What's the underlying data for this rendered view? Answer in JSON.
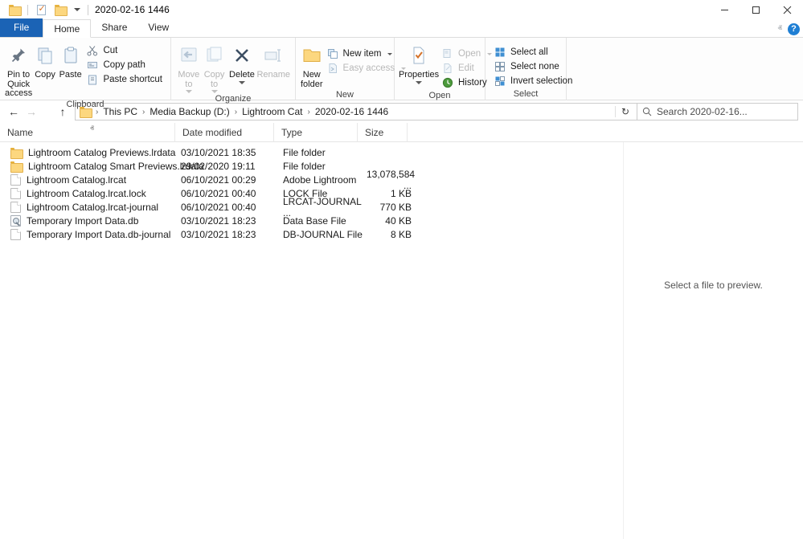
{
  "titlebar": {
    "title": "2020-02-16 1446",
    "quick_access": [
      {
        "name": "folder-icon",
        "label": "Folder"
      },
      {
        "name": "properties-icon",
        "label": "Properties"
      },
      {
        "name": "new-folder-icon",
        "label": "New folder"
      },
      {
        "name": "customize-caret-icon",
        "label": "Customize Quick Access Toolbar"
      }
    ],
    "controls": {
      "minimize": "–",
      "maximize": "□",
      "close": "×"
    }
  },
  "tabs": [
    {
      "label": "File",
      "kind": "file"
    },
    {
      "label": "Home",
      "kind": "active"
    },
    {
      "label": "Share",
      "kind": "normal"
    },
    {
      "label": "View",
      "kind": "normal"
    }
  ],
  "ribbon_right": {
    "collapse": "ⱏ",
    "help": "?"
  },
  "ribbon": {
    "groups": [
      {
        "title": "Clipboard",
        "big": [
          {
            "label": "Pin to Quick\naccess",
            "icon": "pin-icon",
            "disabled": false
          },
          {
            "label": "Copy",
            "icon": "copy-icon",
            "disabled": false
          },
          {
            "label": "Paste",
            "icon": "paste-icon",
            "disabled": false
          }
        ],
        "small": [
          {
            "label": "Cut",
            "icon": "scissors-icon",
            "disabled": false
          },
          {
            "label": "Copy path",
            "icon": "copy-path-icon",
            "disabled": false
          },
          {
            "label": "Paste shortcut",
            "icon": "paste-shortcut-icon",
            "disabled": false
          }
        ]
      },
      {
        "title": "Organize",
        "big": [
          {
            "label": "Move\nto",
            "icon": "move-to-icon",
            "disabled": true,
            "caret": true
          },
          {
            "label": "Copy\nto",
            "icon": "copy-to-icon",
            "disabled": true,
            "caret": true
          },
          {
            "label": "Delete",
            "icon": "delete-x-icon",
            "disabled": false,
            "caret": true
          },
          {
            "label": "Rename",
            "icon": "rename-icon",
            "disabled": true
          }
        ],
        "small": []
      },
      {
        "title": "New",
        "big": [
          {
            "label": "New\nfolder",
            "icon": "new-folder-icon",
            "disabled": false
          }
        ],
        "small": [
          {
            "label": "New item",
            "icon": "new-item-icon",
            "disabled": false,
            "caret": true
          },
          {
            "label": "Easy access",
            "icon": "easy-access-icon",
            "disabled": true,
            "caret": true
          }
        ]
      },
      {
        "title": "Open",
        "big": [
          {
            "label": "Properties",
            "icon": "properties-icon",
            "disabled": false,
            "caret": true
          }
        ],
        "small": [
          {
            "label": "Open",
            "icon": "open-icon",
            "disabled": true,
            "caret": true
          },
          {
            "label": "Edit",
            "icon": "edit-icon",
            "disabled": true
          },
          {
            "label": "History",
            "icon": "history-icon",
            "disabled": false
          }
        ]
      },
      {
        "title": "Select",
        "big": [],
        "small": [
          {
            "label": "Select all",
            "icon": "select-all-icon",
            "disabled": false
          },
          {
            "label": "Select none",
            "icon": "select-none-icon",
            "disabled": false
          },
          {
            "label": "Invert selection",
            "icon": "invert-selection-icon",
            "disabled": false
          }
        ]
      }
    ]
  },
  "navigation": {
    "back": "←",
    "forward": "→",
    "recent": "ⱟ",
    "up": "↑",
    "breadcrumbs": [
      "This PC",
      "Media Backup (D:)",
      "Lightroom Cat",
      "2020-02-16 1446"
    ],
    "separator": "›",
    "dropdown": "ⱟ",
    "refresh": "↻",
    "search_placeholder": "Search 2020-02-16..."
  },
  "columns": [
    {
      "key": "name",
      "label": "Name",
      "sorted": "asc"
    },
    {
      "key": "date",
      "label": "Date modified",
      "sorted": null
    },
    {
      "key": "type",
      "label": "Type",
      "sorted": null
    },
    {
      "key": "size",
      "label": "Size",
      "sorted": null
    }
  ],
  "sort_indicator": "ⱏ",
  "files": [
    {
      "name": "Lightroom Catalog Previews.lrdata",
      "date": "03/10/2021 18:35",
      "type": "File folder",
      "size": "",
      "icon": "folder-icon"
    },
    {
      "name": "Lightroom Catalog Smart Previews.lrdata",
      "date": "29/02/2020 19:11",
      "type": "File folder",
      "size": "",
      "icon": "folder-icon"
    },
    {
      "name": "Lightroom Catalog.lrcat",
      "date": "06/10/2021 00:29",
      "type": "Adobe Lightroom",
      "size": "13,078,584 ...",
      "icon": "file-icon"
    },
    {
      "name": "Lightroom Catalog.lrcat.lock",
      "date": "06/10/2021 00:40",
      "type": "LOCK File",
      "size": "1 KB",
      "icon": "file-icon"
    },
    {
      "name": "Lightroom Catalog.lrcat-journal",
      "date": "06/10/2021 00:40",
      "type": "LRCAT-JOURNAL ...",
      "size": "770 KB",
      "icon": "file-icon"
    },
    {
      "name": "Temporary Import Data.db",
      "date": "03/10/2021 18:23",
      "type": "Data Base File",
      "size": "40 KB",
      "icon": "database-file-icon"
    },
    {
      "name": "Temporary Import Data.db-journal",
      "date": "03/10/2021 18:23",
      "type": "DB-JOURNAL File",
      "size": "8 KB",
      "icon": "file-icon"
    }
  ],
  "preview_pane": {
    "message": "Select a file to preview."
  },
  "colors": {
    "file_tab_blue": "#1b63b5",
    "folder_yellow": "#fcd77f",
    "help_blue": "#1f7fd4",
    "row_hover": "#e5f3fb"
  }
}
